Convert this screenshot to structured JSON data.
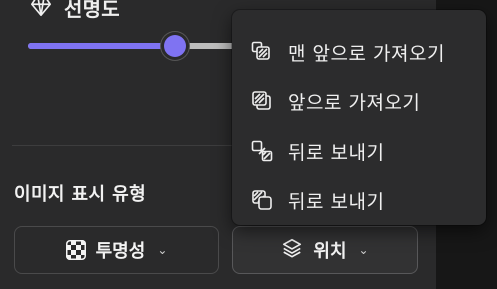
{
  "opacity": {
    "label": "선명도",
    "icon": "diamond-icon",
    "value_fraction": 0.64
  },
  "display_type": {
    "title": "이미지 표시 유형",
    "transparency_button": {
      "label": "투명성",
      "icon": "checkerboard-icon"
    },
    "position_button": {
      "label": "위치",
      "icon": "layers-icon"
    },
    "chevron": "⌄"
  },
  "position_menu": {
    "items": [
      {
        "label": "맨 앞으로 가져오기",
        "icon": "bring-to-front-icon"
      },
      {
        "label": "앞으로 가져오기",
        "icon": "bring-forward-icon"
      },
      {
        "label": "뒤로 보내기",
        "icon": "send-backward-icon"
      },
      {
        "label": "뒤로 보내기",
        "icon": "send-to-back-icon"
      }
    ]
  },
  "colors": {
    "accent": "#7f73f2",
    "panel_bg": "#2a2a2b",
    "menu_bg": "#2c2c2d",
    "text": "#f2f2f2"
  }
}
